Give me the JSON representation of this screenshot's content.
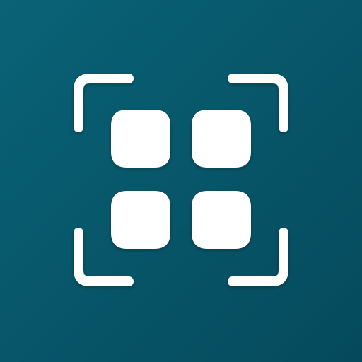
{
  "icon": {
    "name": "scan-grid-icon",
    "background_color": "#075A6C",
    "foreground_color": "#FFFFFF",
    "elements": {
      "frame_corners": [
        "top-left",
        "top-right",
        "bottom-left",
        "bottom-right"
      ],
      "tiles": [
        "top-left",
        "top-right",
        "bottom-left",
        "bottom-right"
      ]
    }
  }
}
